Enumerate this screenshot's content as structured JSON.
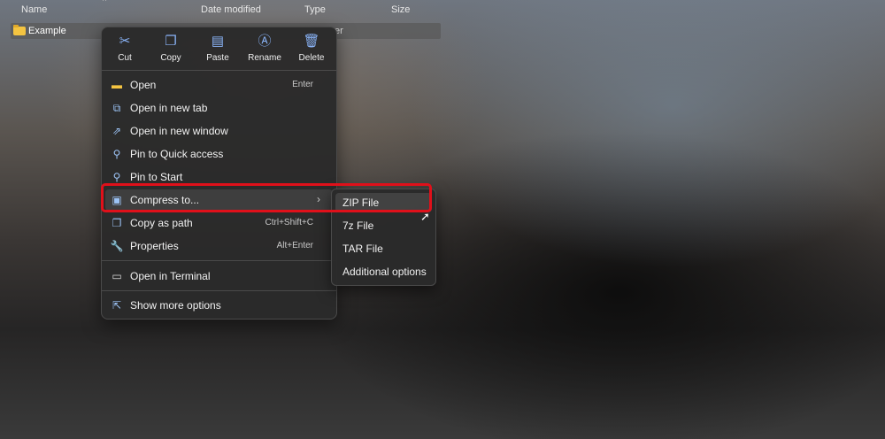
{
  "explorer": {
    "columns": {
      "name": "Name",
      "date_modified": "Date modified",
      "type": "Type",
      "size": "Size"
    },
    "file": {
      "name": "Example",
      "type_fragment": "er"
    }
  },
  "context_menu": {
    "quick_actions": [
      {
        "label": "Cut",
        "icon": "scissors-icon"
      },
      {
        "label": "Copy",
        "icon": "copy-icon"
      },
      {
        "label": "Paste",
        "icon": "paste-icon"
      },
      {
        "label": "Rename",
        "icon": "rename-icon"
      },
      {
        "label": "Delete",
        "icon": "trash-icon"
      }
    ],
    "items": [
      {
        "label": "Open",
        "shortcut": "Enter",
        "icon": "folder-open-icon"
      },
      {
        "label": "Open in new tab",
        "shortcut": "",
        "icon": "new-tab-icon"
      },
      {
        "label": "Open in new window",
        "shortcut": "",
        "icon": "new-window-icon"
      },
      {
        "label": "Pin to Quick access",
        "shortcut": "",
        "icon": "pin-icon"
      },
      {
        "label": "Pin to Start",
        "shortcut": "",
        "icon": "pin-icon"
      },
      {
        "label": "Compress to...",
        "shortcut": "",
        "icon": "archive-icon"
      },
      {
        "label": "Copy as path",
        "shortcut": "Ctrl+Shift+C",
        "icon": "copy-path-icon"
      },
      {
        "label": "Properties",
        "shortcut": "Alt+Enter",
        "icon": "wrench-icon"
      },
      {
        "label": "Open in Terminal",
        "shortcut": "",
        "icon": "terminal-icon"
      },
      {
        "label": "Show more options",
        "shortcut": "",
        "icon": "more-options-icon"
      }
    ]
  },
  "submenu": {
    "items": [
      {
        "label": "ZIP File"
      },
      {
        "label": "7z File"
      },
      {
        "label": "TAR File"
      },
      {
        "label": "Additional options"
      }
    ]
  },
  "colors": {
    "highlight": "#e0101a",
    "menu_bg": "#2a2a2a",
    "accent_icon": "#8ab4f8",
    "folder": "#f4c441"
  }
}
